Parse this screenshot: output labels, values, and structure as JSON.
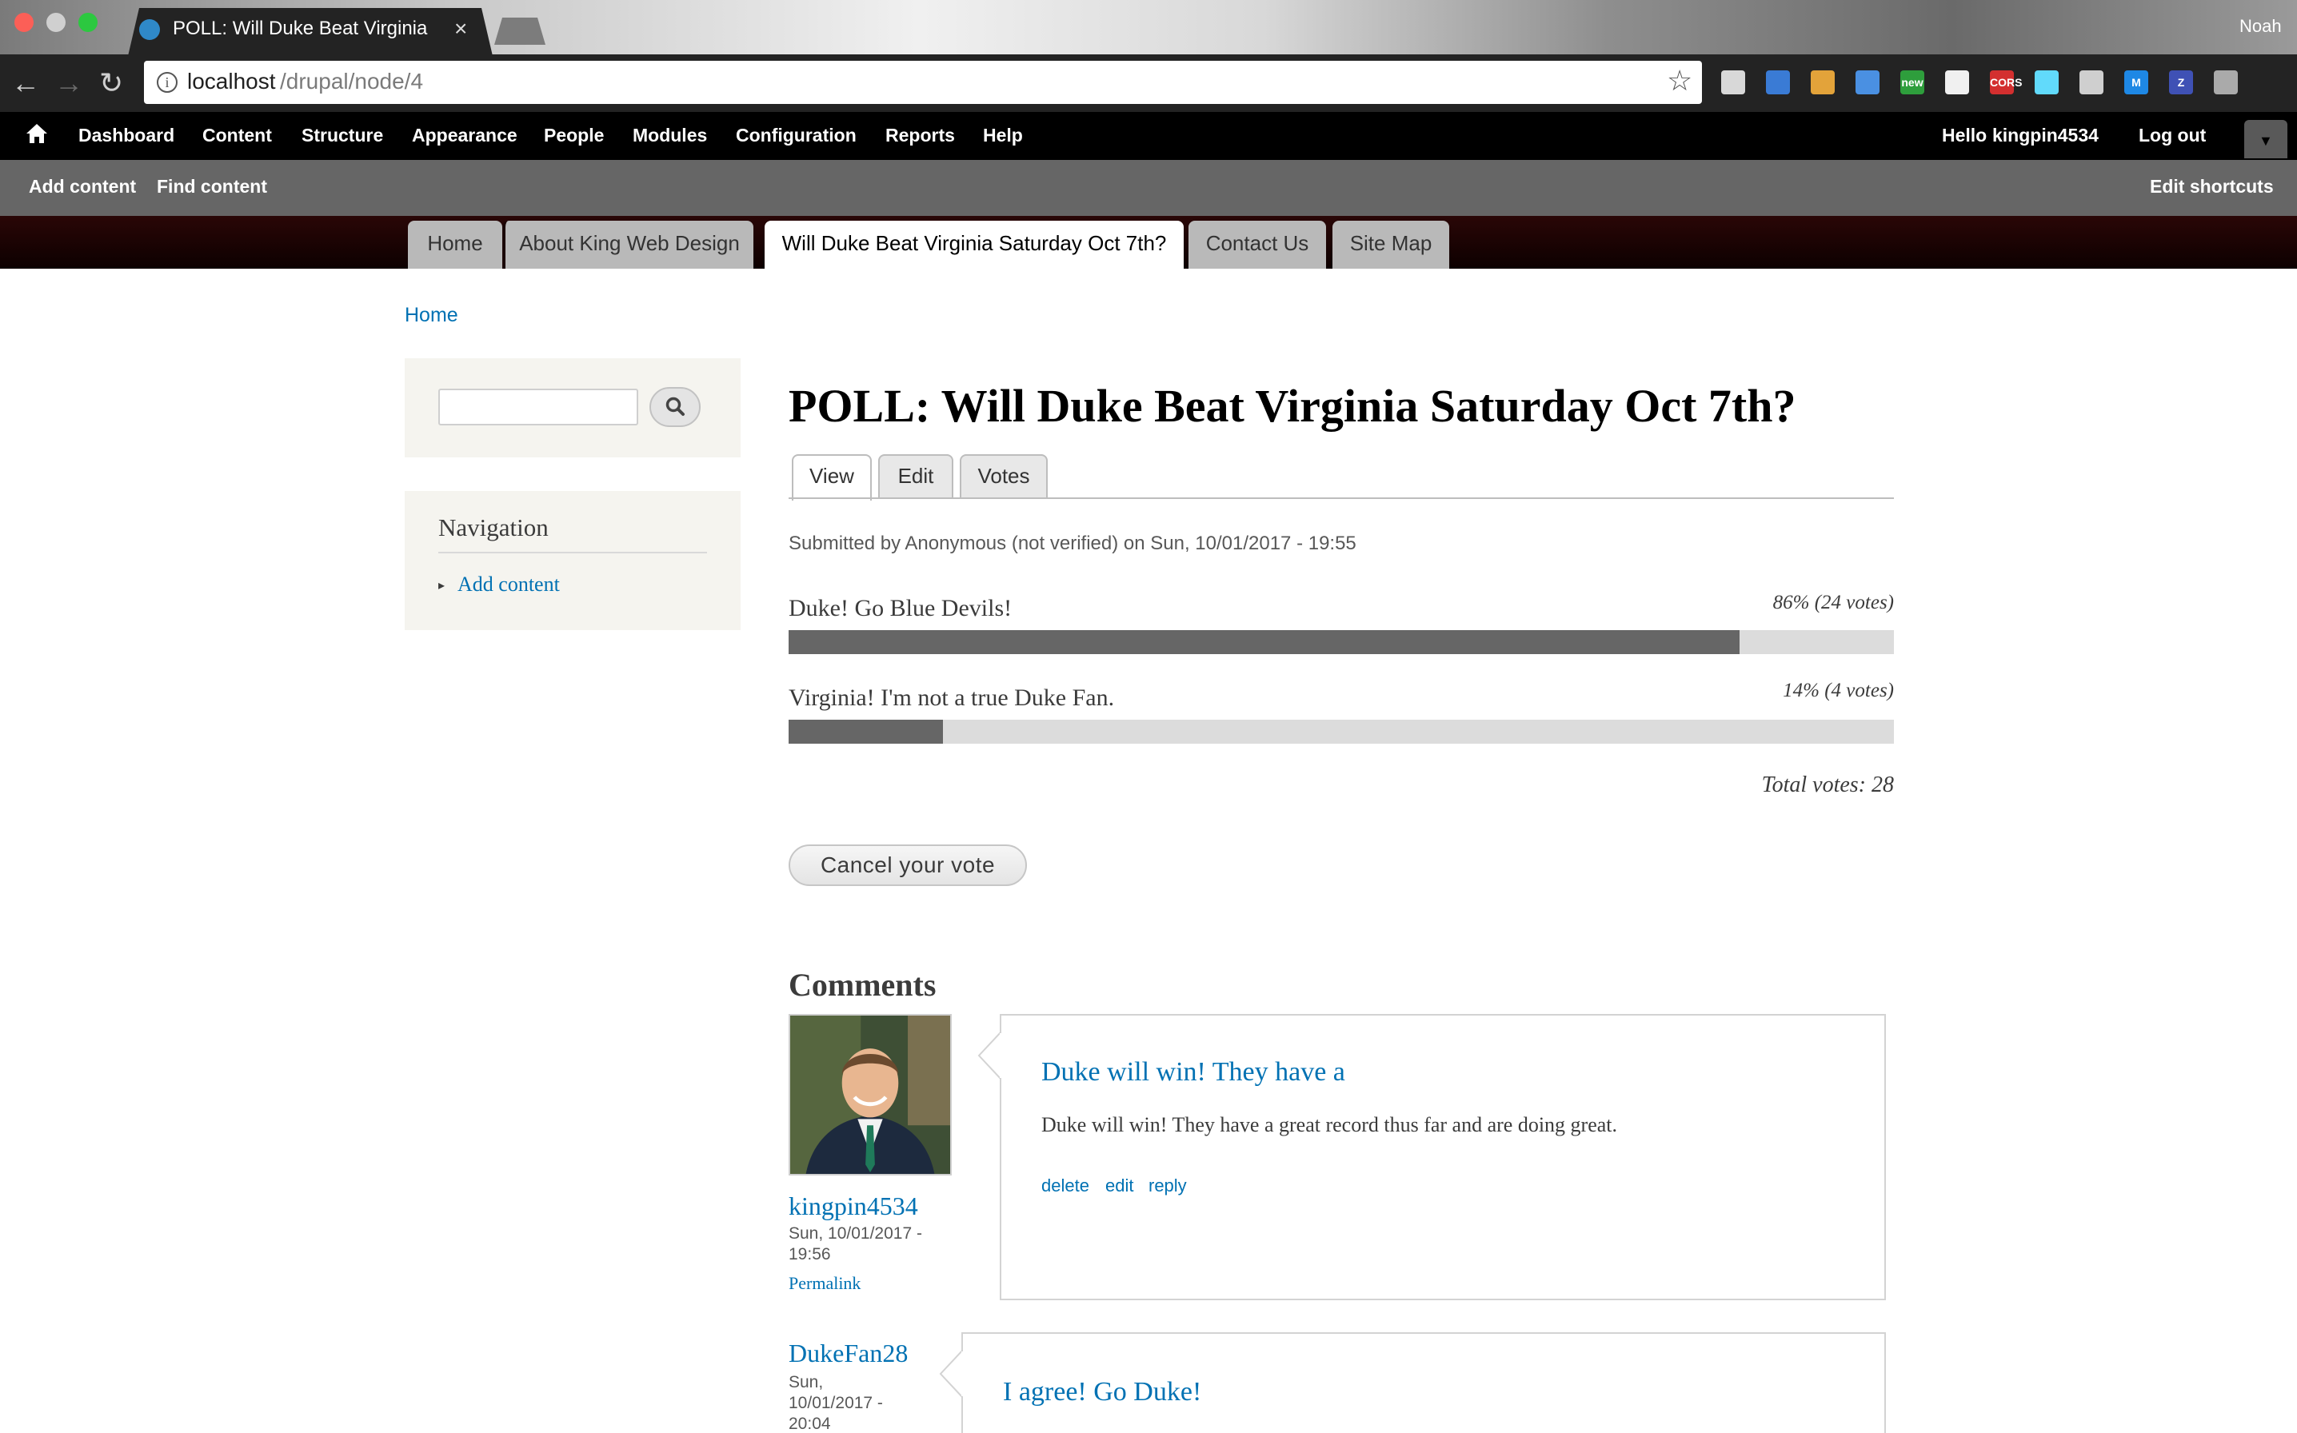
{
  "browser": {
    "tab_title": "POLL: Will Duke Beat Virginia",
    "tab_close": "×",
    "profile_name": "Noah",
    "url_host": "localhost",
    "url_path": "/drupal/node/4",
    "info_glyph": "i",
    "star_glyph": "☆",
    "back_glyph": "←",
    "forward_glyph": "→",
    "reload_glyph": "↻",
    "extensions": [
      "extension-icon",
      "pen-icon",
      "hammer-icon",
      "link-icon",
      "new-badge-icon",
      "circle-icon",
      "cors-icon",
      "react-icon",
      "settings-icon",
      "m-icon",
      "z-icon",
      "menu-icon"
    ],
    "extension_labels": [
      "",
      "",
      "",
      "",
      "new",
      "",
      "CORS",
      "",
      "",
      "M",
      "Z",
      ""
    ],
    "extension_colors": [
      "#d8d8d8",
      "#3a7bd5",
      "#e3a33a",
      "#4a90e2",
      "#2e9e3c",
      "#f0f0f0",
      "#d32f2f",
      "#61dafb",
      "#cfcfcf",
      "#1e88e5",
      "#3f51b5",
      "#aaaaaa"
    ]
  },
  "admin_toolbar": {
    "items": [
      "Dashboard",
      "Content",
      "Structure",
      "Appearance",
      "People",
      "Modules",
      "Configuration",
      "Reports",
      "Help"
    ],
    "greeting": "Hello",
    "username": "kingpin4534",
    "logout": "Log out",
    "toggle_glyph": "▼"
  },
  "shortcuts": {
    "add_content": "Add content",
    "find_content": "Find content",
    "edit_shortcuts": "Edit shortcuts"
  },
  "primary_tabs": [
    "Home",
    "About King Web Design",
    "Will Duke Beat Virginia Saturday Oct 7th?",
    "Contact Us",
    "Site Map"
  ],
  "active_primary_tab": "Will Duke Beat Virginia Saturday Oct 7th?",
  "breadcrumb": "Home",
  "sidebar": {
    "search_placeholder": "",
    "navigation_title": "Navigation",
    "nav_arrow": "▸",
    "nav_items": [
      "Add content"
    ]
  },
  "node": {
    "title": "POLL: Will Duke Beat Virginia Saturday Oct 7th?",
    "local_tabs": [
      "View",
      "Edit",
      "Votes"
    ],
    "active_local_tab": "View",
    "submitted": "Submitted by Anonymous (not verified) on Sun, 10/01/2017 - 19:55",
    "choices": [
      {
        "label": "Duke! Go Blue Devils!",
        "percent": "86% (24 votes)",
        "fill_fraction": 0.86
      },
      {
        "label": "Virginia! I'm not a true Duke Fan.",
        "percent": "14% (4 votes)",
        "fill_fraction": 0.14
      }
    ],
    "total_votes": "Total votes: 28",
    "cancel_vote": "Cancel your vote"
  },
  "comments": {
    "heading": "Comments",
    "items": [
      {
        "author": "kingpin4534",
        "date_line1": "Sun, 10/01/2017 -",
        "date_line2": "19:56",
        "permalink": "Permalink",
        "subject": "Duke will win! They have a",
        "body": "Duke will win! They have a great record thus far and are doing great.",
        "links": [
          "delete",
          "edit",
          "reply"
        ]
      },
      {
        "author": "DukeFan28",
        "date_line1": "Sun,",
        "date_line2": "10/01/2017 -",
        "date_line3": "20:04",
        "subject": "I agree! Go Duke!"
      }
    ]
  },
  "colors": {
    "link": "#0071b3",
    "admin_bar": "#000000",
    "shortcut_bar": "#666666",
    "header": "#1a0303",
    "poll_bar": "#666666"
  }
}
